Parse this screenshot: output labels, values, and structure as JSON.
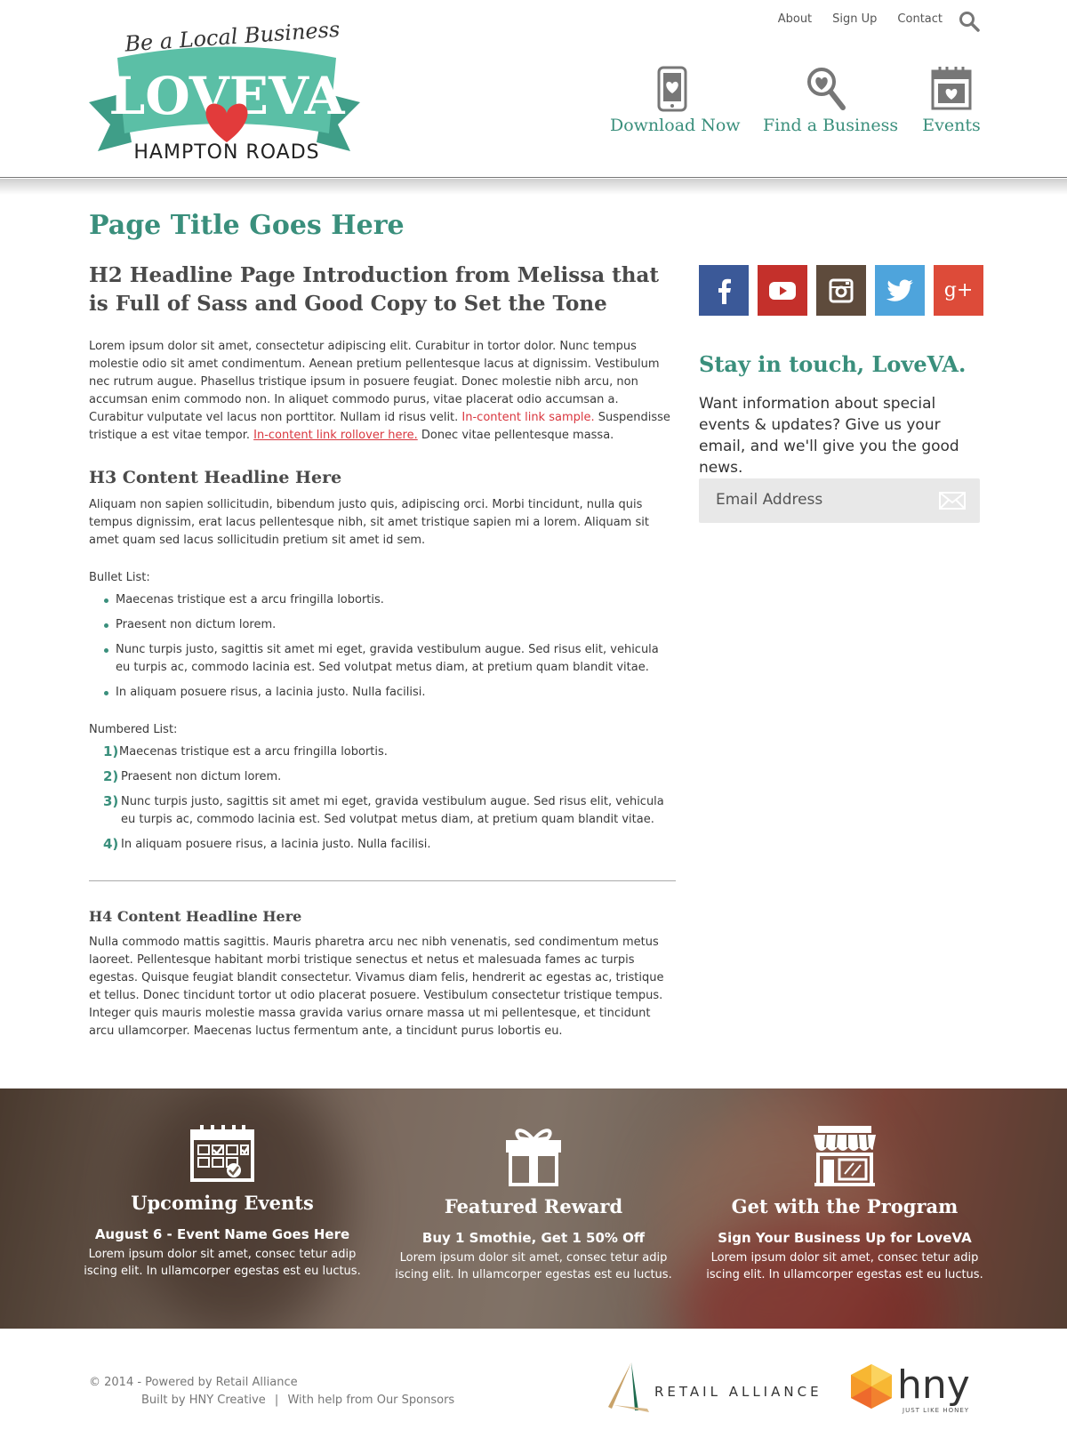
{
  "header": {
    "logo": {
      "tagline": "Be a Local Business",
      "brand": "LOVEVA",
      "region": "HAMPTON ROADS"
    },
    "top_links": [
      "About",
      "Sign Up",
      "Contact"
    ],
    "nav": [
      {
        "label": "Download Now",
        "icon": "phone-heart-icon"
      },
      {
        "label": "Find a Business",
        "icon": "magnifier-heart-icon"
      },
      {
        "label": "Events",
        "icon": "calendar-heart-icon"
      }
    ]
  },
  "main": {
    "page_title": "Page Title Goes Here",
    "h2": "H2 Headline Page Introduction from Melissa that is Full of Sass and Good Copy to Set the Tone",
    "intro_part1": "Lorem ipsum dolor sit amet, consectetur adipiscing elit. Curabitur in tortor dolor. Nunc tempus molestie odio sit amet condimentum. Aenean pretium pellentesque lacus at dignissim. Vestibulum nec rutrum augue. Phasellus tristique ipsum in posuere feugiat. Donec molestie nibh arcu, non accumsan enim commodo non. In aliquet commodo purus, vitae placerat odio accumsan a. Curabitur vulputate vel lacus non porttitor. Nullam id risus velit. ",
    "intro_link": "In-content link sample.",
    "intro_part2": " Suspendisse tristique a est vitae tempor. ",
    "intro_link_rollover": "In-content link rollover here.",
    "intro_part3": " Donec vitae pellentesque massa.",
    "h3": "H3 Content Headline Here",
    "h3_text": "Aliquam non sapien sollicitudin, bibendum justo quis, adipiscing orci. Morbi tincidunt, nulla quis tempus dignissim, erat lacus pellentesque nibh, sit amet tristique sapien mi a lorem. Aliquam sit amet quam sed lacus sollicitudin pretium sit amet id sem.",
    "bullet_label": "Bullet List:",
    "bullets": [
      "Maecenas tristique est a arcu fringilla lobortis.",
      "Praesent non dictum lorem.",
      "Nunc turpis justo, sagittis sit amet mi eget, gravida vestibulum augue. Sed risus elit, vehicula eu turpis ac, commodo lacinia est. Sed volutpat metus diam, at pretium quam blandit vitae.",
      "In aliquam posuere risus, a lacinia justo. Nulla facilisi."
    ],
    "numbered_label": "Numbered List:",
    "numbered": [
      {
        "num": "1)",
        "text": "Maecenas tristique est a arcu fringilla lobortis."
      },
      {
        "num": "2)",
        "text": "Praesent non dictum lorem."
      },
      {
        "num": "3)",
        "text": "Nunc turpis justo, sagittis sit amet mi eget, gravida vestibulum augue. Sed risus elit, vehicula eu turpis ac, commodo lacinia est. Sed volutpat metus diam, at pretium quam blandit vitae."
      },
      {
        "num": "4)",
        "text": "In aliquam posuere risus, a lacinia justo. Nulla facilisi."
      }
    ],
    "h4": "H4 Content Headline Here",
    "h4_text": "Nulla commodo mattis sagittis. Mauris pharetra arcu nec nibh venenatis, sed condimentum metus laoreet. Pellentesque habitant morbi tristique senectus et netus et malesuada fames ac turpis egestas. Quisque feugiat blandit consectetur. Vivamus diam felis, hendrerit ac egestas ac, tristique et tellus. Donec tincidunt tortor ut odio placerat posuere. Vestibulum consectetur tristique tempus. Integer quis mauris molestie massa gravida varius ornare massa ut mi pellentesque, et tincidunt arcu ullamcorper. Maecenas luctus fermentum ante, a tincidunt purus lobortis eu."
  },
  "sidebar": {
    "social": [
      {
        "name": "facebook-icon",
        "color": "#3b5998"
      },
      {
        "name": "youtube-icon",
        "color": "#c4302b"
      },
      {
        "name": "instagram-icon",
        "color": "#5e4b3c"
      },
      {
        "name": "twitter-icon",
        "color": "#4ea4dc"
      },
      {
        "name": "google-plus-icon",
        "color": "#dd4b39"
      }
    ],
    "stay_title": "Stay in touch, LoveVA.",
    "stay_text": "Want information about special events & updates? Give us your email, and we'll give you the good news.",
    "email_placeholder": "Email Address"
  },
  "promo": [
    {
      "icon": "calendar-check-icon",
      "title": "Upcoming Events",
      "subtitle": "August 6 - Event Name Goes Here",
      "text": "Lorem ipsum dolor sit amet, consec tetur adip iscing elit. In ullamcorper egestas est eu luctus."
    },
    {
      "icon": "gift-icon",
      "title": "Featured Reward",
      "subtitle": "Buy 1 Smothie, Get 1 50% Off",
      "text": "Lorem ipsum dolor sit amet, consec tetur adip iscing elit. In ullamcorper egestas est eu luctus."
    },
    {
      "icon": "storefront-icon",
      "title": "Get with the Program",
      "subtitle": "Sign Your Business Up for LoveVA",
      "text": "Lorem ipsum dolor sit amet, consec tetur adip iscing elit. In ullamcorper egestas est eu luctus."
    }
  ],
  "footer": {
    "copyright": "© 2014 - Powered by Retail Alliance",
    "built_by": "Built by HNY Creative",
    "separator": "|",
    "sponsors": "With help from Our Sponsors",
    "retail_alliance": "RETAIL ALLIANCE",
    "hny": "hny",
    "hny_tagline": "JUST LIKE HONEY"
  },
  "colors": {
    "brand_teal": "#3a8f7c",
    "link_red": "#d9363e",
    "logo_teal": "#5bbfa6",
    "heart_red": "#e23b3b"
  }
}
